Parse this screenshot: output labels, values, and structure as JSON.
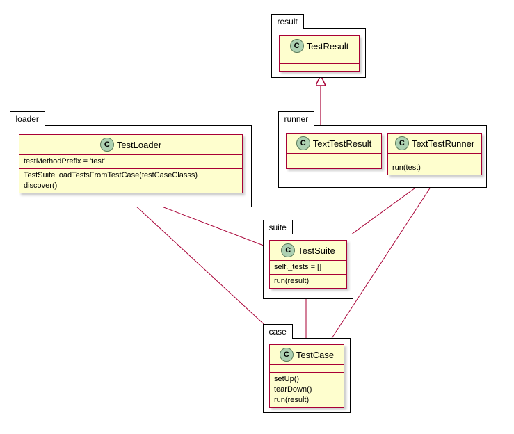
{
  "packages": {
    "result": {
      "label": "result"
    },
    "loader": {
      "label": "loader"
    },
    "runner": {
      "label": "runner"
    },
    "suite": {
      "label": "suite"
    },
    "case": {
      "label": "case"
    }
  },
  "classes": {
    "TestResult": {
      "name": "TestResult"
    },
    "TestLoader": {
      "name": "TestLoader",
      "attrs": [
        "testMethodPrefix = 'test'"
      ],
      "methods": [
        "TestSuite loadTestsFromTestCase(testCaseClasss)",
        "discover()"
      ]
    },
    "TextTestResult": {
      "name": "TextTestResult"
    },
    "TextTestRunner": {
      "name": "TextTestRunner",
      "methods": [
        "run(test)"
      ]
    },
    "TestSuite": {
      "name": "TestSuite",
      "attrs": [
        "self._tests = []"
      ],
      "methods": [
        "run(result)"
      ]
    },
    "TestCase": {
      "name": "TestCase",
      "methods": [
        "setUp()",
        "tearDown()",
        "run(result)"
      ]
    }
  },
  "chart_data": {
    "type": "uml_class_diagram",
    "packages": [
      {
        "name": "result",
        "classes": [
          "TestResult"
        ]
      },
      {
        "name": "loader",
        "classes": [
          "TestLoader"
        ]
      },
      {
        "name": "runner",
        "classes": [
          "TextTestResult",
          "TextTestRunner"
        ]
      },
      {
        "name": "suite",
        "classes": [
          "TestSuite"
        ]
      },
      {
        "name": "case",
        "classes": [
          "TestCase"
        ]
      }
    ],
    "classes": [
      {
        "name": "TestResult",
        "attributes": [],
        "methods": []
      },
      {
        "name": "TestLoader",
        "attributes": [
          "testMethodPrefix = 'test'"
        ],
        "methods": [
          "TestSuite loadTestsFromTestCase(testCaseClasss)",
          "discover()"
        ]
      },
      {
        "name": "TextTestResult",
        "attributes": [],
        "methods": []
      },
      {
        "name": "TextTestRunner",
        "attributes": [],
        "methods": [
          "run(test)"
        ]
      },
      {
        "name": "TestSuite",
        "attributes": [
          "self._tests = []"
        ],
        "methods": [
          "run(result)"
        ]
      },
      {
        "name": "TestCase",
        "attributes": [],
        "methods": [
          "setUp()",
          "tearDown()",
          "run(result)"
        ]
      }
    ],
    "relationships": [
      {
        "from": "TextTestResult",
        "to": "TestResult",
        "type": "inheritance"
      },
      {
        "from": "TestLoader",
        "to": "TestSuite",
        "type": "association"
      },
      {
        "from": "TestLoader",
        "to": "TestCase",
        "type": "association"
      },
      {
        "from": "TextTestRunner",
        "to": "TestSuite",
        "type": "association"
      },
      {
        "from": "TextTestRunner",
        "to": "TestCase",
        "type": "association"
      },
      {
        "from": "TestSuite",
        "to": "TestCase",
        "type": "association"
      }
    ]
  }
}
